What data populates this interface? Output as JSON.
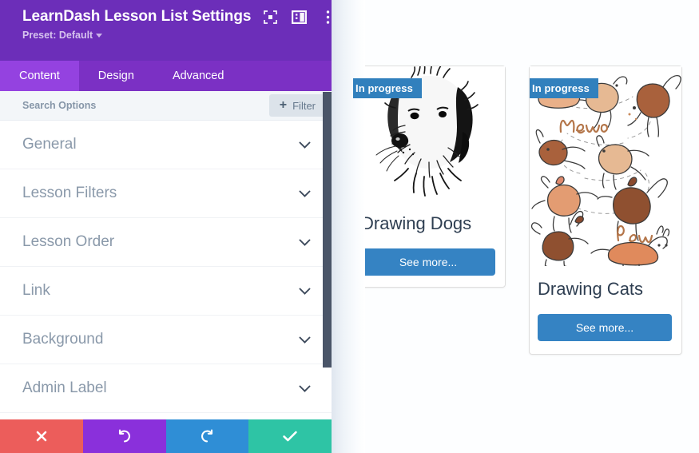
{
  "panel": {
    "header": {
      "title": "LearnDash Lesson List Settings",
      "preset_label": "Preset: Default",
      "icons": [
        {
          "name": "focus-icon"
        },
        {
          "name": "layout-panel-icon"
        },
        {
          "name": "more-vertical-icon"
        }
      ]
    },
    "tabs": [
      {
        "label": "Content",
        "active": true
      },
      {
        "label": "Design",
        "active": false
      },
      {
        "label": "Advanced",
        "active": false
      }
    ],
    "search": {
      "value": "",
      "placeholder": "Search Options",
      "filter_label": "Filter",
      "filter_plus": "+"
    },
    "accordion": [
      {
        "label": "General"
      },
      {
        "label": "Lesson Filters"
      },
      {
        "label": "Lesson Order"
      },
      {
        "label": "Link"
      },
      {
        "label": "Background"
      },
      {
        "label": "Admin Label"
      }
    ],
    "footer_buttons": [
      {
        "name": "discard-button",
        "icon": "close-icon",
        "glyph": "✖",
        "color": "#ec5d5b"
      },
      {
        "name": "undo-button",
        "icon": "undo-icon",
        "glyph": "↺",
        "color": "#8a30db"
      },
      {
        "name": "redo-button",
        "icon": "redo-icon",
        "glyph": "↻",
        "color": "#2f8ed6"
      },
      {
        "name": "save-button",
        "icon": "check-icon",
        "glyph": "✔",
        "color": "#2ec4a5"
      }
    ]
  },
  "canvas": {
    "cards": [
      {
        "badge": "In progress",
        "title": "Drawing Dogs",
        "button": "See more...",
        "thumb": "dog-sketch-image"
      },
      {
        "badge": "In progress",
        "title": "Drawing Cats",
        "button": "See more...",
        "thumb": "cat-doodles-image"
      }
    ]
  },
  "colors": {
    "brand_purple": "#6c2eb9",
    "tab_active": "#9442e0",
    "badge_blue": "#3180bd",
    "button_blue": "#3583c3",
    "scrollbar": "#4a5568"
  }
}
